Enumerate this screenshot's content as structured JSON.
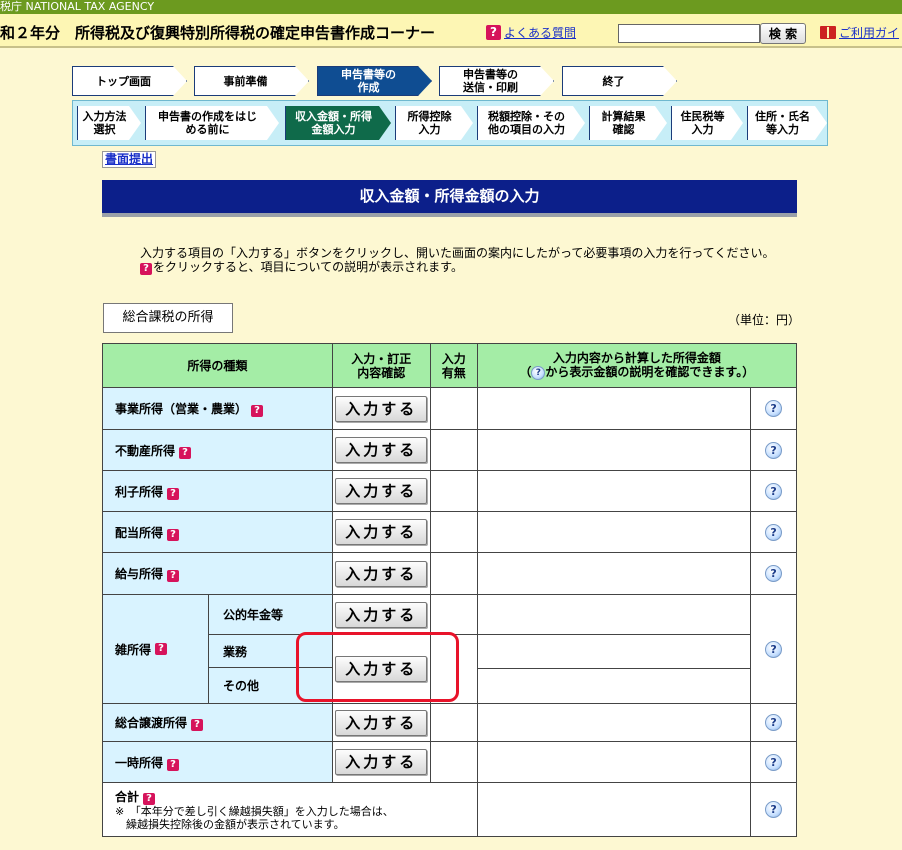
{
  "header": {
    "agency": "税庁 NATIONAL TAX AGENCY",
    "title": "和２年分　所得税及び復興特別所得税の確定申告書作成コーナー",
    "faq_icon": "?",
    "faq_label": "よくある質問",
    "search_placeholder": "",
    "search_button": "検 索",
    "guide_label": "ご利用ガイ"
  },
  "steps_main": [
    {
      "label": "トップ画面"
    },
    {
      "label": "事前準備"
    },
    {
      "label": "申告書等の\n作成"
    },
    {
      "label": "申告書等の\n送信・印刷"
    },
    {
      "label": "終了"
    }
  ],
  "steps_sub": [
    {
      "label": "入力方法\n選択"
    },
    {
      "label": "申告書の作成をはじ\nめる前に"
    },
    {
      "label": "収入金額・所得\n金額入力"
    },
    {
      "label": "所得控除\n入力"
    },
    {
      "label": "税額控除・その\n他の項目の入力"
    },
    {
      "label": "計算結果\n確認"
    },
    {
      "label": "住民税等\n入力"
    },
    {
      "label": "住所・氏名\n等入力"
    }
  ],
  "submit_link": "書面提出",
  "section_title": "収入金額・所得金額の入力",
  "instructions": {
    "line1": "入力する項目の「入力する」ボタンをクリックし、開いた画面の案内にしたがって必要事項の入力を行ってください。",
    "line2": "をクリックすると、項目についての説明が表示されます。"
  },
  "category_label": "総合課税の所得",
  "unit_label": "（単位：円）",
  "table": {
    "headers": {
      "type": "所得の種類",
      "action": "入力・訂正\n内容確認",
      "entered": "入力\n有無",
      "amount_line1": "入力内容から計算した所得金額",
      "amount_line2": "から表示金額の説明を確認できます。）",
      "amount_prefix": "（"
    },
    "enter_label": "入力する",
    "help_glyph": "?",
    "rows": [
      {
        "name": "事業所得（営業・農業）"
      },
      {
        "name": "不動産所得"
      },
      {
        "name": "利子所得"
      },
      {
        "name": "配当所得"
      },
      {
        "name": "給与所得"
      }
    ],
    "misc": {
      "name": "雑所得",
      "sub1": "公的年金等",
      "sub2": "業務",
      "sub3": "その他"
    },
    "rows_after": [
      {
        "name": "総合譲渡所得"
      },
      {
        "name": "一時所得"
      }
    ],
    "total": {
      "name": "合計",
      "note": "※　「本年分で差し引く繰越損失額」を入力した場合は、\n　繰越損失控除後の金額が表示されています。"
    }
  }
}
